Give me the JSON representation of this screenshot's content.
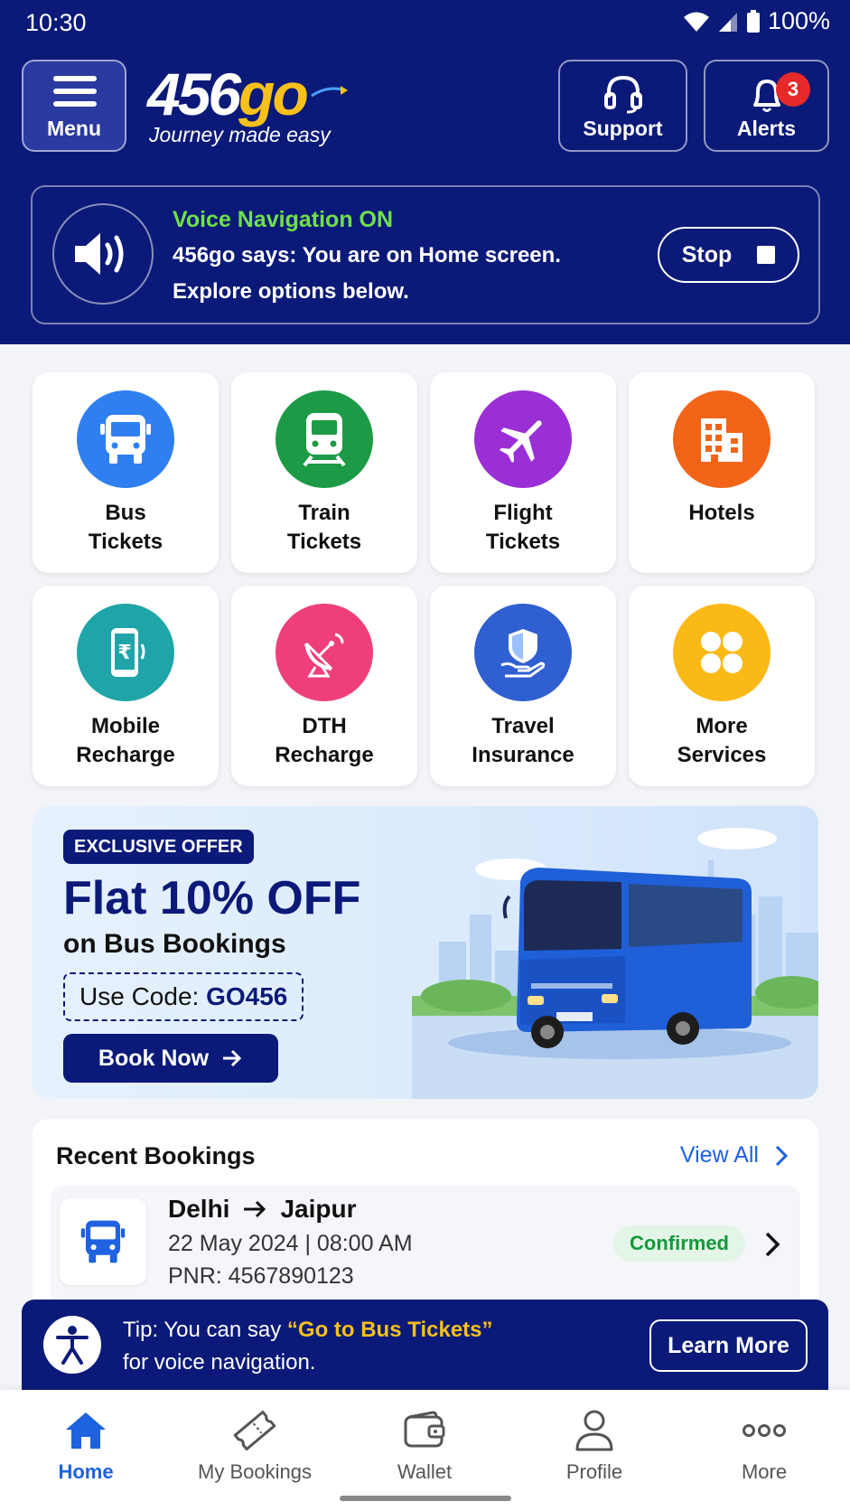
{
  "status_bar": {
    "time": "10:30",
    "battery": "100%"
  },
  "header": {
    "menu_label": "Menu",
    "logo_text": "456",
    "logo_text_accent": "go",
    "tagline": "Journey made easy",
    "support_label": "Support",
    "alerts_label": "Alerts",
    "alerts_count": "3"
  },
  "voice": {
    "title": "Voice Navigation ON",
    "line1": "456go says: You are on Home screen.",
    "line2": "Explore options below.",
    "stop_label": "Stop"
  },
  "services": [
    {
      "line1": "Bus",
      "line2": "Tickets",
      "color": "#2f7ff0",
      "icon": "bus-icon"
    },
    {
      "line1": "Train",
      "line2": "Tickets",
      "color": "#1d9a45",
      "icon": "train-icon"
    },
    {
      "line1": "Flight",
      "line2": "Tickets",
      "color": "#9a2fd6",
      "icon": "flight-icon"
    },
    {
      "line1": "Hotels",
      "line2": "",
      "color": "#f26418",
      "icon": "hotel-icon"
    },
    {
      "line1": "Mobile",
      "line2": "Recharge",
      "color": "#1fa5a8",
      "icon": "mobile-recharge-icon"
    },
    {
      "line1": "DTH",
      "line2": "Recharge",
      "color": "#ee3f7c",
      "icon": "satellite-dish-icon"
    },
    {
      "line1": "Travel",
      "line2": "Insurance",
      "color": "#2f5fd0",
      "icon": "insurance-shield-icon"
    },
    {
      "line1": "More",
      "line2": "Services",
      "color": "#fbb916",
      "icon": "grid-dots-icon"
    }
  ],
  "offer": {
    "tag": "EXCLUSIVE OFFER",
    "title": "Flat 10% OFF",
    "subtitle": "on Bus Bookings",
    "code_prefix": "Use Code: ",
    "code": "GO456",
    "button_label": "Book Now"
  },
  "recent": {
    "title": "Recent Bookings",
    "view_all": "View All",
    "booking": {
      "from": "Delhi",
      "to": "Jaipur",
      "date": "22 May 2024 | 08:00 AM",
      "pnr": "PNR: 4567890123",
      "status": "Confirmed"
    }
  },
  "tip": {
    "prefix": "Tip: You can say ",
    "phrase": "“Go to Bus Tickets”",
    "line2": "for voice navigation.",
    "button_label": "Learn More"
  },
  "nav": [
    {
      "label": "Home",
      "icon": "home-icon",
      "active": true
    },
    {
      "label": "My Bookings",
      "icon": "ticket-icon",
      "active": false
    },
    {
      "label": "Wallet",
      "icon": "wallet-icon",
      "active": false
    },
    {
      "label": "Profile",
      "icon": "profile-icon",
      "active": false
    },
    {
      "label": "More",
      "icon": "more-dots-icon",
      "active": false
    }
  ],
  "colors": {
    "brand": "#0b1a78",
    "accent": "#f7c01a",
    "link": "#1e62e0",
    "success": "#15973a"
  }
}
